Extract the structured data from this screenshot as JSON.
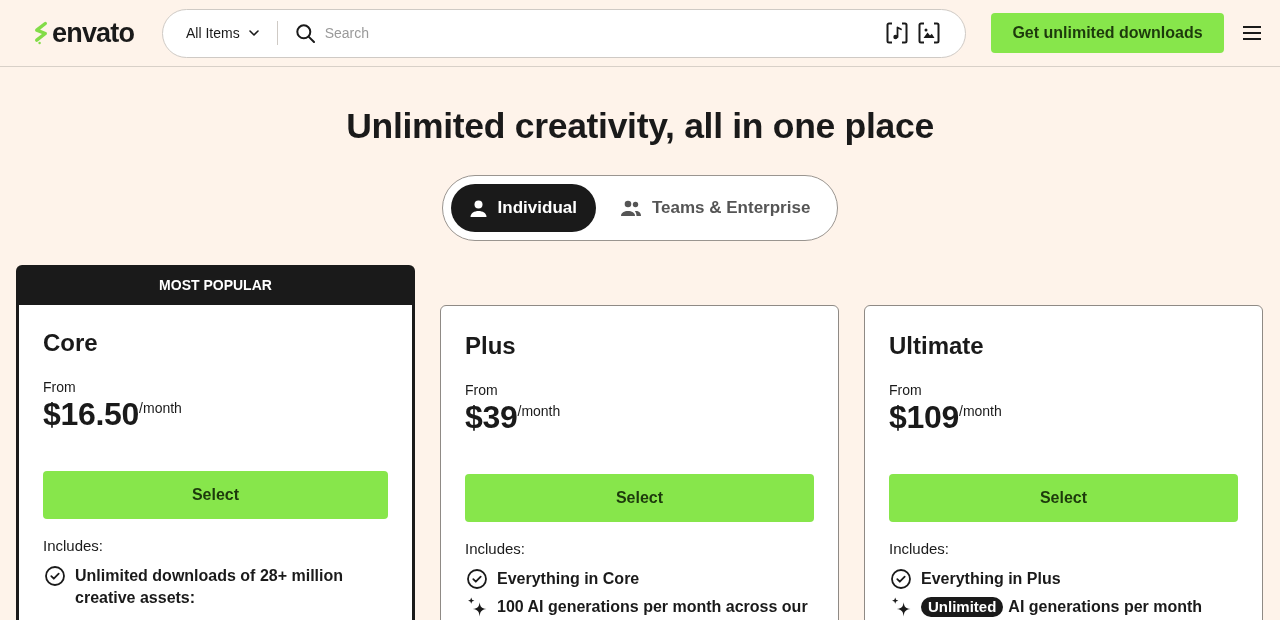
{
  "header": {
    "logo": "envato",
    "search": {
      "category": "All Items",
      "placeholder": "Search"
    },
    "cta": "Get unlimited downloads"
  },
  "hero": {
    "title": "Unlimited creativity, all in one place"
  },
  "tabs": [
    {
      "label": "Individual",
      "selected": true,
      "kind": "person"
    },
    {
      "label": "Teams & Enterprise",
      "selected": false,
      "kind": "group"
    }
  ],
  "plans": [
    {
      "badge": "MOST POPULAR",
      "name": "Core",
      "from": "From",
      "price": "$16.50",
      "period": "/month",
      "button": "Select",
      "includes_label": "Includes:",
      "features": [
        {
          "kind": "check",
          "text": "Unlimited downloads of 28+ million creative assets:"
        }
      ]
    },
    {
      "name": "Plus",
      "from": "From",
      "price": "$39",
      "period": "/month",
      "button": "Select",
      "includes_label": "Includes:",
      "features": [
        {
          "kind": "check",
          "text": "Everything in Core"
        },
        {
          "kind": "sparkle",
          "text": "100 AI generations per month across our"
        }
      ]
    },
    {
      "name": "Ultimate",
      "from": "From",
      "price": "$109",
      "period": "/month",
      "button": "Select",
      "includes_label": "Includes:",
      "features": [
        {
          "kind": "check",
          "text": "Everything in Plus"
        },
        {
          "kind": "sparkle",
          "tag": "Unlimited",
          "text": "AI generations per month"
        }
      ]
    }
  ]
}
